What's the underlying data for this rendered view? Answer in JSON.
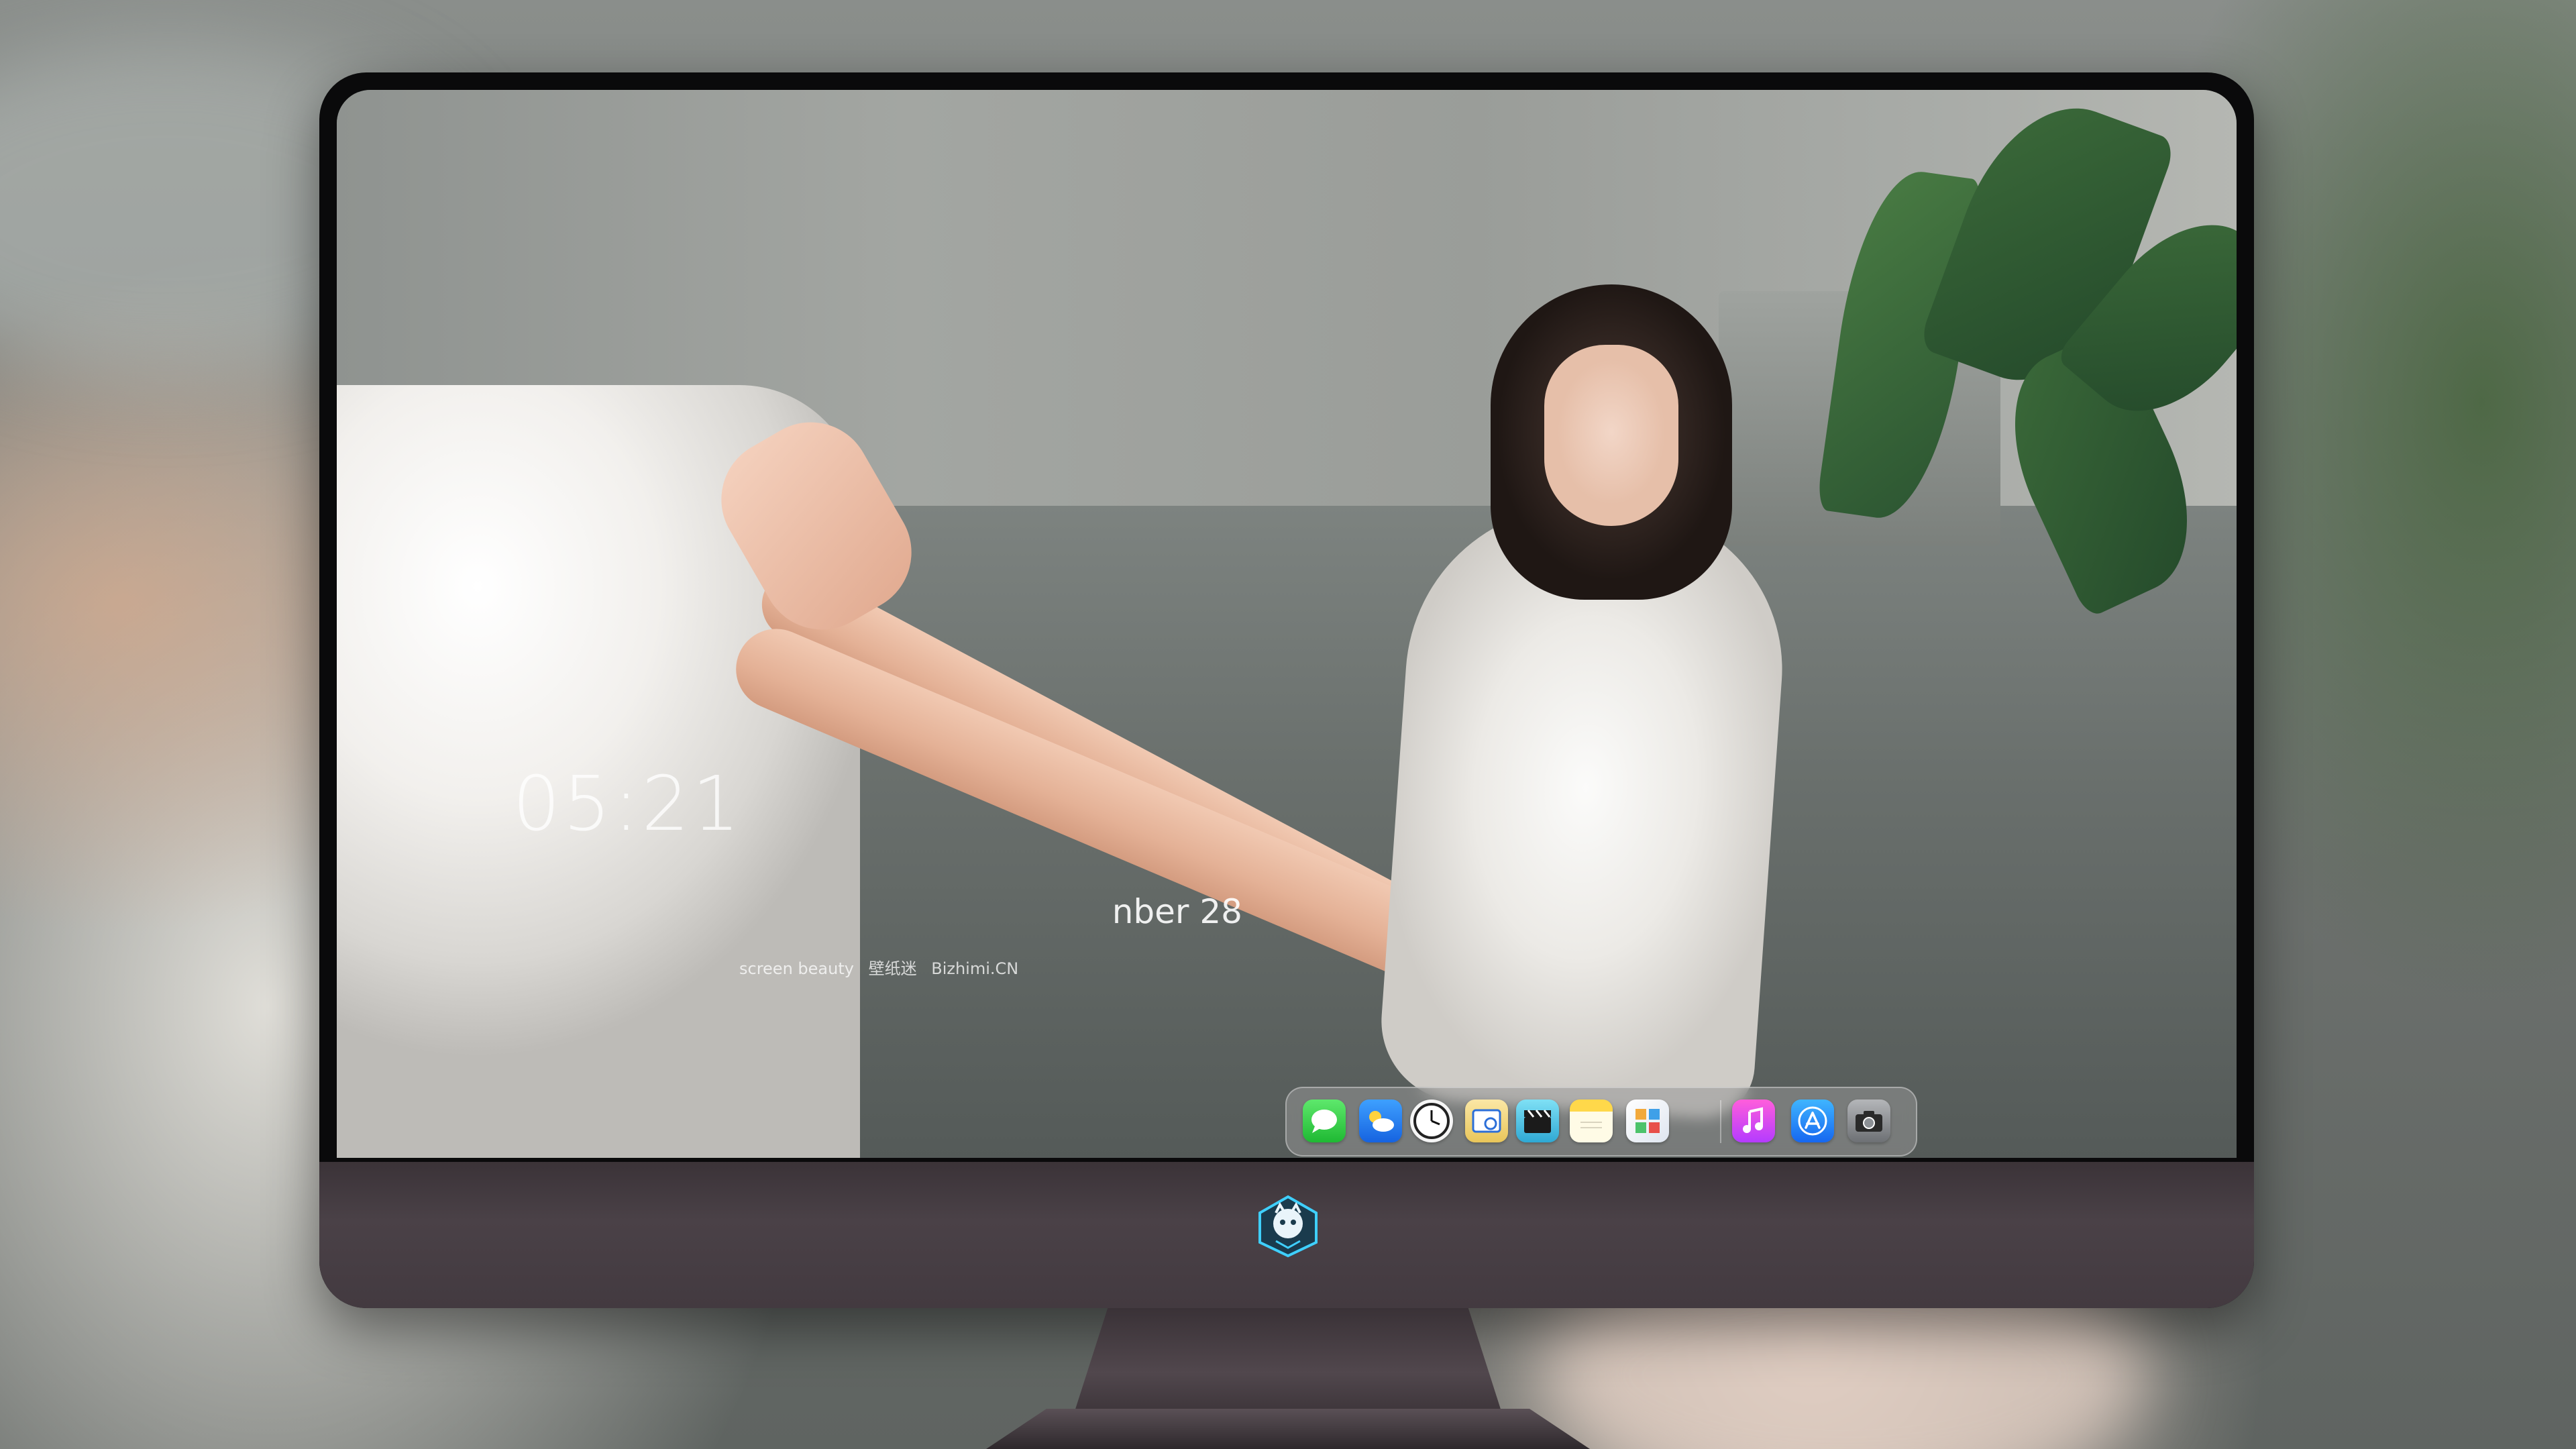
{
  "lockscreen": {
    "time": "05:21",
    "date": "nber  28",
    "credit": [
      "screen beauty",
      "壁纸迷",
      "Bizhimi.CN"
    ]
  },
  "dock": {
    "apps": [
      {
        "name": "Messages",
        "icon": "speech-bubble-icon"
      },
      {
        "name": "Weather",
        "icon": "cloud-sun-icon"
      },
      {
        "name": "Clock",
        "icon": "clock-icon"
      },
      {
        "name": "Preview",
        "icon": "preview-icon"
      },
      {
        "name": "Clips",
        "icon": "clapperboard-icon"
      },
      {
        "name": "Notes",
        "icon": "notes-icon"
      },
      {
        "name": "Finder",
        "icon": "photos-grid-icon"
      },
      {
        "name": "Music",
        "icon": "music-note-icon"
      },
      {
        "name": "App Store",
        "icon": "app-store-icon"
      },
      {
        "name": "Camera",
        "icon": "camera-icon"
      }
    ]
  },
  "colors": {
    "monitor_bezel": "#0a0a0b",
    "monitor_chin": "#433a40",
    "dock_background": "rgba(150,150,150,0.55)"
  }
}
